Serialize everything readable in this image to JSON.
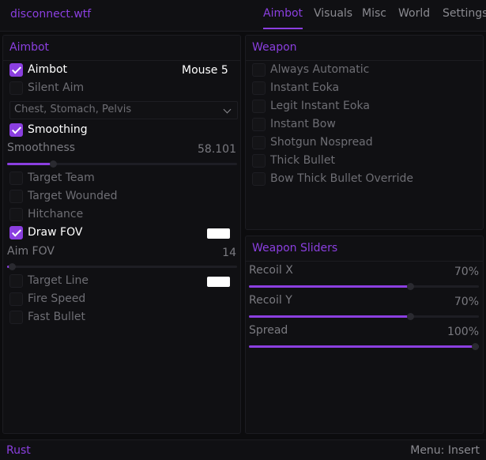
{
  "app": {
    "brand": "disconnect.wtf"
  },
  "tabs": [
    {
      "label": "Aimbot",
      "active": true
    },
    {
      "label": "Visuals",
      "active": false
    },
    {
      "label": "Misc",
      "active": false
    },
    {
      "label": "World",
      "active": false
    },
    {
      "label": "Settings",
      "active": false
    }
  ],
  "aimbot_panel": {
    "title": "Aimbot",
    "aimbot": {
      "label": "Aimbot",
      "checked": true,
      "keybind": "Mouse 5"
    },
    "silent_aim": {
      "label": "Silent Aim",
      "checked": false
    },
    "hitbox_dropdown": {
      "value": "Chest, Stomach, Pelvis"
    },
    "smoothing": {
      "label": "Smoothing",
      "checked": true
    },
    "smoothness": {
      "label": "Smoothness",
      "value": "58.101",
      "fraction": 0.2
    },
    "target_team": {
      "label": "Target Team",
      "checked": false
    },
    "target_wounded": {
      "label": "Target Wounded",
      "checked": false
    },
    "hitchance": {
      "label": "Hitchance",
      "checked": false
    },
    "draw_fov": {
      "label": "Draw FOV",
      "checked": true,
      "color": "#ffffff"
    },
    "aim_fov": {
      "label": "Aim FOV",
      "value": "14",
      "fraction": 0.02
    },
    "target_line": {
      "label": "Target Line",
      "checked": false,
      "color": "#ffffff"
    },
    "fire_speed": {
      "label": "Fire Speed",
      "checked": false
    },
    "fast_bullet": {
      "label": "Fast Bullet",
      "checked": false
    }
  },
  "weapon_panel": {
    "title": "Weapon",
    "items": [
      {
        "label": "Always Automatic",
        "checked": false
      },
      {
        "label": "Instant Eoka",
        "checked": false
      },
      {
        "label": "Legit Instant Eoka",
        "checked": false
      },
      {
        "label": "Instant Bow",
        "checked": false
      },
      {
        "label": "Shotgun Nospread",
        "checked": false
      },
      {
        "label": "Thick Bullet",
        "checked": false
      },
      {
        "label": "Bow Thick Bullet Override",
        "checked": false
      }
    ]
  },
  "weapon_sliders": {
    "title": "Weapon Sliders",
    "recoil_x": {
      "label": "Recoil X",
      "value": "70%",
      "fraction": 0.7
    },
    "recoil_y": {
      "label": "Recoil Y",
      "value": "70%",
      "fraction": 0.7
    },
    "spread": {
      "label": "Spread",
      "value": "100%",
      "fraction": 1.0
    }
  },
  "footer": {
    "game": "Rust",
    "menu_key": "Menu: Insert"
  },
  "colors": {
    "accent": "#8b3fe0",
    "background": "#0c0c0e",
    "panel": "#101013"
  }
}
